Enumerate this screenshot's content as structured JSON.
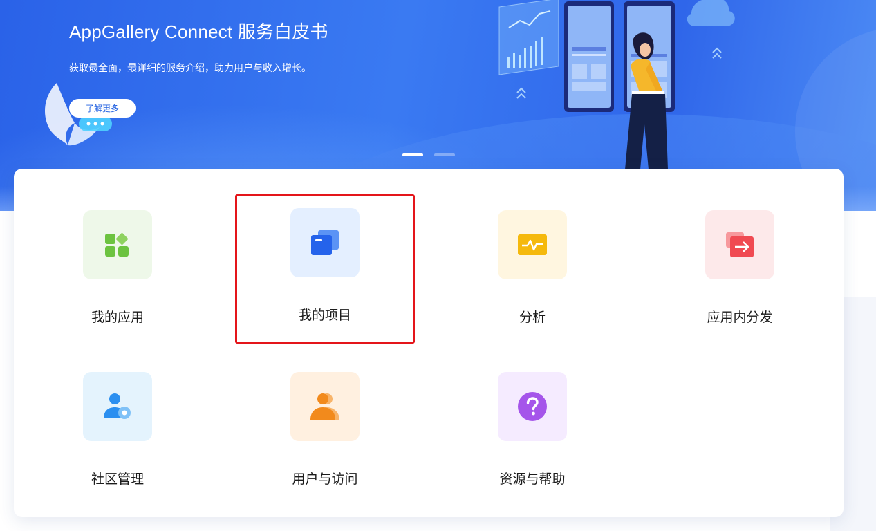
{
  "banner": {
    "title": "AppGallery Connect 服务白皮书",
    "subtitle": "获取最全面，最详细的服务介绍，助力用户与收入增长。",
    "cta_label": "了解更多",
    "slide_count": 2,
    "active_slide": 1
  },
  "services": [
    {
      "id": "my-apps",
      "label": "我的应用",
      "icon": "apps-grid-icon",
      "icon_color": "#6cc340",
      "bg_color": "#eef8e9"
    },
    {
      "id": "my-projects",
      "label": "我的项目",
      "icon": "project-stack-icon",
      "icon_color": "#2563eb",
      "bg_color": "#e4efff",
      "selected": true
    },
    {
      "id": "analytics",
      "label": "分析",
      "icon": "analytics-pulse-icon",
      "icon_color": "#f5b90d",
      "bg_color": "#fff6e0"
    },
    {
      "id": "in-app-distribution",
      "label": "应用内分发",
      "icon": "distribution-arrow-icon",
      "icon_color": "#f04a52",
      "bg_color": "#fde9ea"
    },
    {
      "id": "community-management",
      "label": "社区管理",
      "icon": "user-gear-icon",
      "icon_color": "#2b8ff0",
      "bg_color": "#e4f3fd"
    },
    {
      "id": "users-access",
      "label": "用户与访问",
      "icon": "users-icon",
      "icon_color": "#f28a1c",
      "bg_color": "#fff0e0"
    },
    {
      "id": "resources-help",
      "label": "资源与帮助",
      "icon": "help-question-icon",
      "icon_color": "#a555ea",
      "bg_color": "#f5ebff"
    }
  ],
  "colors": {
    "accent": "#1f5fe0",
    "selection_outline": "#e4151a"
  }
}
